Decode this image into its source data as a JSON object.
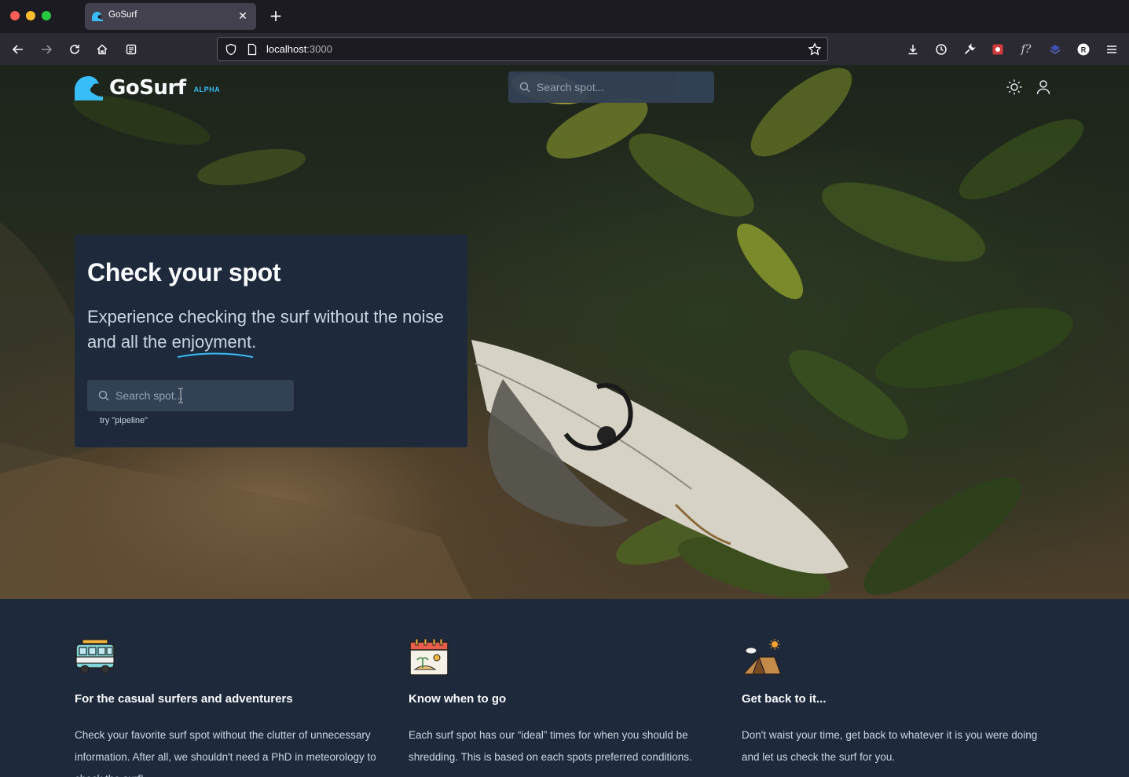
{
  "browser": {
    "tab_title": "GoSurf",
    "url_host": "localhost",
    "url_port": ":3000",
    "icons": [
      "back-icon",
      "forward-icon",
      "reload-icon",
      "home-icon",
      "reader-icon",
      "shield-icon",
      "page-icon",
      "bookmark-star-icon",
      "download-icon",
      "history-icon",
      "wrench-icon",
      "extension-icon",
      "formula-icon",
      "layers-icon",
      "profile-icon",
      "menu-icon"
    ]
  },
  "header": {
    "brand_name": "GoSurf",
    "brand_badge": "ALPHA",
    "search_placeholder": "Search spot...",
    "icons": [
      "sun-icon",
      "user-icon"
    ]
  },
  "hero": {
    "title": "Check your spot",
    "subtitle": "Experience checking the surf without the noise and all the enjoyment.",
    "search_placeholder": "Search spot...",
    "hint": "try \"pipeline\""
  },
  "features": [
    {
      "icon": "van-icon",
      "title": "For the casual surfers and adventurers",
      "text": "Check your favorite surf spot without the clutter of unnecessary information. After all, we shouldn't need a PhD in meteorology to check the surf!"
    },
    {
      "icon": "calendar-icon",
      "title": "Know when to go",
      "text": "Each surf spot has our “ideal” times for when you should be shredding. This is based on each spots preferred conditions."
    },
    {
      "icon": "tent-icon",
      "title": "Get back to it...",
      "text": "Don't waist your time, get back to whatever it is you were doing and let us check the surf for you."
    }
  ],
  "colors": {
    "accent": "#38bdf8",
    "card_bg": "#1e293b",
    "input_bg": "#334155"
  }
}
